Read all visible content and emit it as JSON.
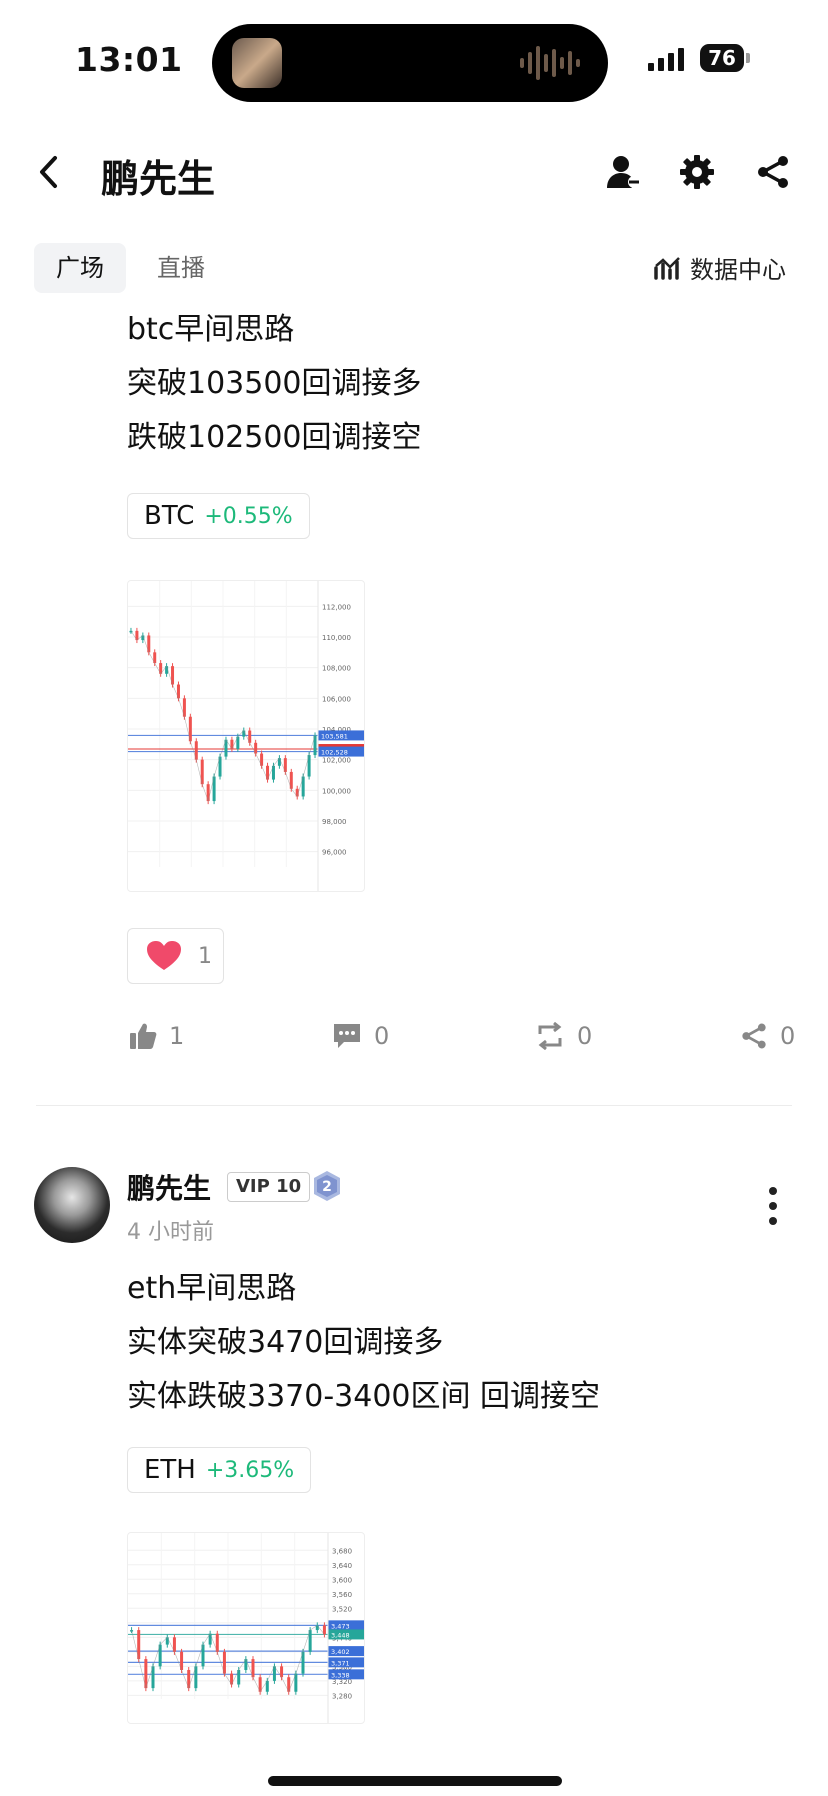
{
  "status_bar": {
    "time": "13:01",
    "battery": "76"
  },
  "header": {
    "title": "鹏先生",
    "back_icon": "chevron-left-icon"
  },
  "tabs": [
    {
      "label": "广场",
      "active": true
    },
    {
      "label": "直播",
      "active": false
    }
  ],
  "data_center": {
    "label": "数据中心"
  },
  "post1": {
    "lines": [
      "btc早间思路",
      "突破103500回调接多",
      "跌破102500回调接空"
    ],
    "tag": {
      "symbol": "BTC",
      "change": "+0.55%"
    },
    "reaction": {
      "emoji": "heart",
      "count": "1"
    },
    "actions": {
      "like": "1",
      "comment": "0",
      "repost": "0",
      "share": "0"
    }
  },
  "post2": {
    "author": "鹏先生",
    "vip": "VIP 10",
    "level": "2",
    "time_ago": "4 小时前",
    "lines": [
      "eth早间思路",
      "实体突破3470回调接多",
      "实体跌破3370-3400区间 回调接空"
    ],
    "tag": {
      "symbol": "ETH",
      "change": "+3.65%"
    }
  },
  "chart_data": [
    {
      "type": "line",
      "title": "",
      "y_ticks": [
        "112,000",
        "110,000",
        "108,000",
        "106,000",
        "104,000",
        "102,000",
        "100,000",
        "98,000",
        "96,000"
      ],
      "ylim": [
        95000,
        113000
      ],
      "price_labels": [
        "103,581",
        "102,694",
        "102,528"
      ],
      "values": [
        110400,
        109800,
        110100,
        109000,
        108300,
        107600,
        108100,
        106900,
        106000,
        104800,
        103200,
        102000,
        100400,
        99300,
        100900,
        102200,
        103300,
        102700,
        103500,
        103900,
        103100,
        102400,
        101600,
        100700,
        101600,
        102100,
        101200,
        100100,
        99600,
        100900,
        102300,
        103581
      ]
    },
    {
      "type": "line",
      "title": "",
      "y_ticks": [
        "3,680",
        "3,640",
        "3,600",
        "3,560",
        "3,520",
        "3,480",
        "3,440",
        "3,400",
        "3,360",
        "3,320",
        "3,280"
      ],
      "ylim": [
        3270,
        3700
      ],
      "price_labels": [
        "3,473",
        "3,448",
        "3,402",
        "3,371",
        "3,338"
      ],
      "values": [
        3460,
        3380,
        3300,
        3360,
        3420,
        3440,
        3400,
        3350,
        3300,
        3360,
        3420,
        3450,
        3400,
        3340,
        3310,
        3350,
        3380,
        3330,
        3290,
        3320,
        3360,
        3330,
        3290,
        3340,
        3400,
        3460,
        3473,
        3448
      ]
    }
  ]
}
